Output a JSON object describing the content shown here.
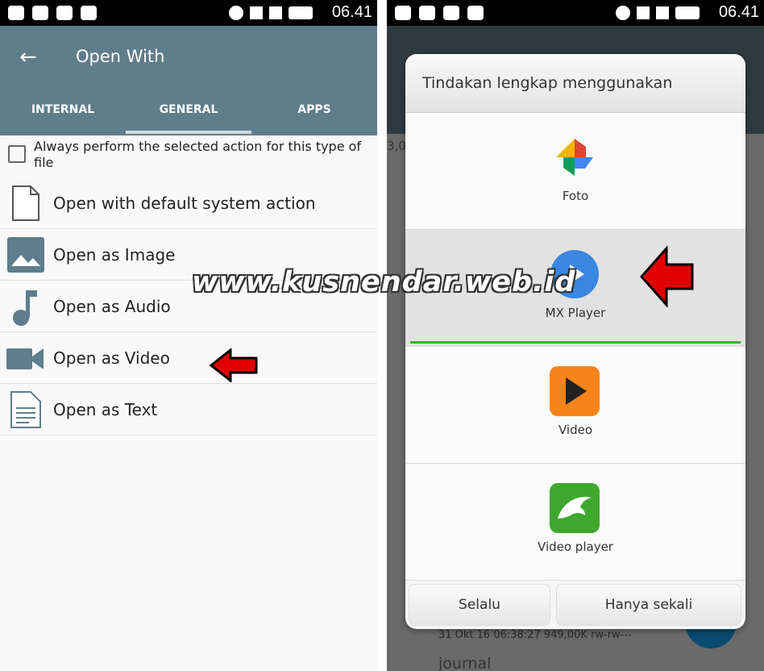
{
  "status": {
    "time": "06.41"
  },
  "left": {
    "title": "Open With",
    "tabs": [
      {
        "label": "INTERNAL"
      },
      {
        "label": "GENERAL",
        "selected": true
      },
      {
        "label": "APPS"
      }
    ],
    "always_checkbox": {
      "label": "Always perform the selected action for this type of file",
      "checked": false
    },
    "items": [
      {
        "label": "Open with default system action",
        "icon": "file-icon"
      },
      {
        "label": "Open as Image",
        "icon": "image-icon"
      },
      {
        "label": "Open as Audio",
        "icon": "music-note-icon"
      },
      {
        "label": "Open as Video",
        "icon": "videocam-icon"
      },
      {
        "label": "Open as Text",
        "icon": "text-file-icon"
      }
    ]
  },
  "right": {
    "dialog_title": "Tindakan lengkap menggunakan",
    "apps": [
      {
        "label": "Foto",
        "icon": "google-photos-icon"
      },
      {
        "label": "MX Player",
        "icon": "mx-player-icon",
        "selected": true
      },
      {
        "label": "Video",
        "icon": "video-app-icon"
      },
      {
        "label": "Video player",
        "icon": "dolphin-video-player-icon"
      }
    ],
    "buttons": {
      "always": "Selalu",
      "once": "Hanya sekali"
    },
    "background": {
      "size_prefix": "3,0",
      "file_meta": "31 Okt 16 06:38:27  949,00K  rw-rw---",
      "file_name": "journal"
    }
  },
  "watermark": "www.kusnendar.web.id",
  "colors": {
    "appbar": "#607d8b",
    "selection_bar": "#3cae2c",
    "arrow": "#e00000"
  }
}
